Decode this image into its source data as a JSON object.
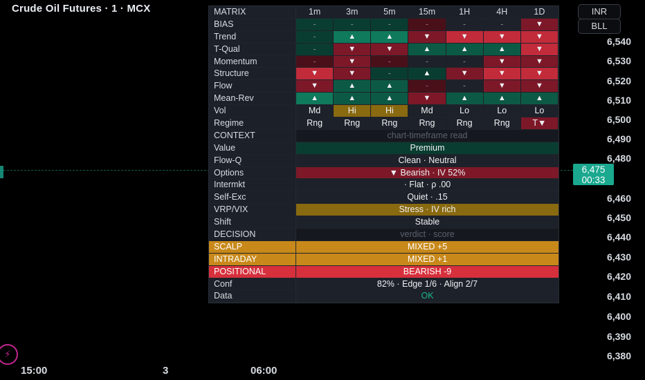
{
  "chart": {
    "title": "Crude Oil Futures · 1 · MCX",
    "currency": "INR",
    "unit": "BLL",
    "price": "6,475",
    "countdown": "00:33",
    "price_axis": [
      "6,540",
      "6,530",
      "6,520",
      "6,510",
      "6,500",
      "6,490",
      "6,480",
      "6,460",
      "6,450",
      "6,440",
      "6,430",
      "6,420",
      "6,410",
      "6,400",
      "6,390",
      "6,380"
    ],
    "time_axis": [
      "15:00",
      "3",
      "06:00"
    ]
  },
  "matrix": {
    "header": "MATRIX",
    "timeframes": [
      "1m",
      "3m",
      "5m",
      "15m",
      "1H",
      "4H",
      "1D"
    ],
    "rows": [
      {
        "label": "BIAS",
        "cells": [
          "-",
          "-",
          "-",
          "-",
          "-",
          "-",
          "▼"
        ]
      },
      {
        "label": "Trend",
        "cells": [
          "-",
          "▲",
          "▲",
          "▼",
          "▼",
          "▼",
          "▼"
        ]
      },
      {
        "label": "T-Qual",
        "cells": [
          "-",
          "▼",
          "▼",
          "▲",
          "▲",
          "▲",
          "▼"
        ]
      },
      {
        "label": "Momentum",
        "cells": [
          "-",
          "▼",
          "-",
          "-",
          "-",
          "▼",
          "▼"
        ]
      },
      {
        "label": "Structure",
        "cells": [
          "▼",
          "▼",
          "-",
          "▲",
          "▼",
          "▼",
          "▼"
        ]
      },
      {
        "label": "Flow",
        "cells": [
          "▼",
          "▲",
          "▲",
          "-",
          "-",
          "▼",
          "▼"
        ]
      },
      {
        "label": "Mean-Rev",
        "cells": [
          "▲",
          "▲",
          "▲",
          "▼",
          "▲",
          "▲",
          "▲"
        ]
      },
      {
        "label": "Vol",
        "cells": [
          "Md",
          "Hi",
          "Hi",
          "Md",
          "Lo",
          "Lo",
          "Lo"
        ]
      },
      {
        "label": "Regime",
        "cells": [
          "Rng",
          "Rng",
          "Rng",
          "Rng",
          "Rng",
          "Rng",
          "T▼"
        ]
      }
    ]
  },
  "context": {
    "header": "CONTEXT",
    "subheader": "chart-timeframe read",
    "rows": [
      {
        "label": "Value",
        "value": "Premium"
      },
      {
        "label": "Flow-Q",
        "value": "Clean · Neutral"
      },
      {
        "label": "Options",
        "value": "▼ Bearish · IV 52%"
      },
      {
        "label": "Intermkt",
        "value": "· Flat · ρ .00"
      },
      {
        "label": "Self-Exc",
        "value": "Quiet · .15"
      },
      {
        "label": "VRP/VIX",
        "value": "Stress · IV rich"
      },
      {
        "label": "Shift",
        "value": "Stable"
      }
    ]
  },
  "decision": {
    "header": "DECISION",
    "subheader": "verdict · score",
    "rows": [
      {
        "label": "SCALP",
        "value": "MIXED +5"
      },
      {
        "label": "INTRADAY",
        "value": "MIXED +1"
      },
      {
        "label": "POSITIONAL",
        "value": "BEARISH -9"
      },
      {
        "label": "Conf",
        "value": "82% · Edge 1/6 · Align 2/7"
      },
      {
        "label": "Data",
        "value": "OK"
      }
    ]
  },
  "colors": {
    "up": "#0f7a5c",
    "down": "#c22b3a",
    "amber": "#c8891a",
    "price": "#1aa88f"
  }
}
